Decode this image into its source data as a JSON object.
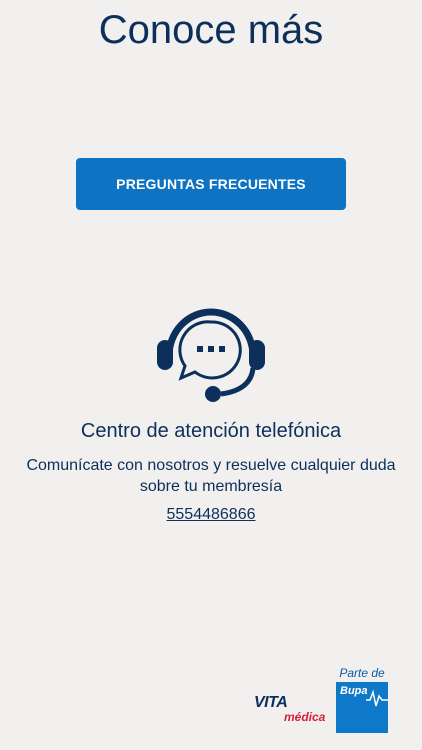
{
  "header": {
    "title": "Conoce más"
  },
  "faq": {
    "button_label": "PREGUNTAS FRECUENTES"
  },
  "support": {
    "title": "Centro de atención telefónica",
    "description": "Comunícate con nosotros y resuelve cualquier duda sobre tu membresía",
    "phone": "5554486866",
    "icon": "headset-chat-icon"
  },
  "branding": {
    "vita": "VITA",
    "medica": "médica",
    "bupa_tagline": "Parte de",
    "bupa_name": "Bupa"
  },
  "colors": {
    "primary": "#0d2f5c",
    "button": "#0f73c3",
    "background": "#f1f0ee",
    "accent_red": "#d7203c",
    "bupa_blue": "#0f79c9"
  }
}
